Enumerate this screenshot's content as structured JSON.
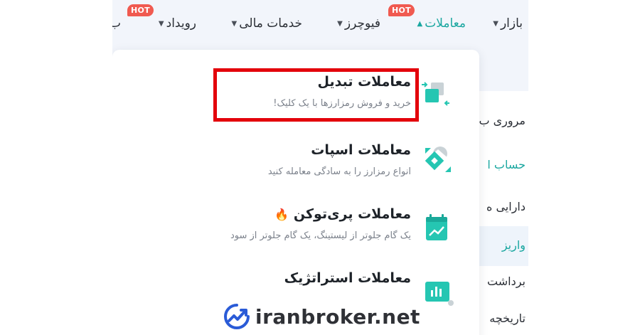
{
  "nav": {
    "items": [
      {
        "label": "بازار",
        "has_caret": true,
        "hot": false,
        "active": false
      },
      {
        "label": "معاملات",
        "has_caret": true,
        "hot": true,
        "active": true
      },
      {
        "label": "فیوچرز",
        "has_caret": true,
        "hot": false,
        "active": false
      },
      {
        "label": "خدمات مالی",
        "has_caret": true,
        "hot": false,
        "active": false
      },
      {
        "label": "رویداد",
        "has_caret": true,
        "hot": true,
        "active": false
      },
      {
        "label": "ب",
        "has_caret": false,
        "hot": false,
        "active": false
      }
    ],
    "hot_badge": "HOT"
  },
  "dropdown": {
    "items": [
      {
        "title": "معاملات تبدیل",
        "desc": "خرید و فروش رمزارزها با یک کلیک!",
        "icon": "convert-icon",
        "highlighted": true
      },
      {
        "title": "معاملات اسپات",
        "desc": "انواع رمزارز را به سادگی معامله کنید",
        "icon": "spot-icon",
        "highlighted": false
      },
      {
        "title": "معاملات پری‌توکن",
        "desc": "یک گام جلوتر از لیستینگ، یک گام جلوتر از سود",
        "icon": "pretoken-icon",
        "highlighted": false,
        "emoji": "🔥"
      },
      {
        "title": "معاملات استراتژیک",
        "desc": "",
        "icon": "strategy-icon",
        "highlighted": false
      }
    ]
  },
  "sidebar": {
    "items": [
      {
        "label": "مروری ب"
      },
      {
        "label": "حساب ا"
      },
      {
        "label": "دارایی ه"
      },
      {
        "label": "واریز"
      },
      {
        "label": "برداشت"
      },
      {
        "label": "تاریخچه"
      }
    ]
  },
  "watermark": {
    "text": "iranbroker.net"
  },
  "colors": {
    "accent": "#1aa7a0",
    "highlight_border": "#e3020b",
    "hot_badge": "#f05a50"
  }
}
